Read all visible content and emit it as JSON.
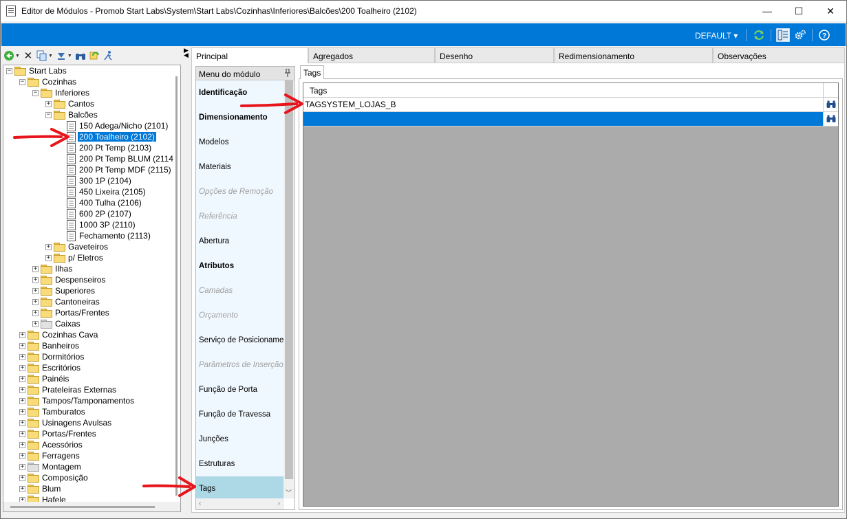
{
  "window": {
    "title": "Editor de Módulos - Promob Start Labs\\System\\Start Labs\\Cozinhas\\Inferiores\\Balcões\\200 Toalheiro (2102)",
    "minimize": "—",
    "maximize": "☐",
    "close": "✕"
  },
  "ribbon": {
    "default_label": "DEFAULT ▾",
    "icons": [
      "refresh-icon",
      "layout-icon",
      "settings-icon",
      "help-icon"
    ]
  },
  "tree": {
    "items": [
      {
        "label": "Start Labs",
        "level": 0,
        "type": "folder",
        "expander": "−"
      },
      {
        "label": "Cozinhas",
        "level": 1,
        "type": "folder",
        "expander": "−"
      },
      {
        "label": "Inferiores",
        "level": 2,
        "type": "folder",
        "expander": "−"
      },
      {
        "label": "Cantos",
        "level": 3,
        "type": "folder",
        "expander": "+"
      },
      {
        "label": "Balcões",
        "level": 3,
        "type": "folder",
        "expander": "−"
      },
      {
        "label": "150 Adega/Nicho (2101)",
        "level": 4,
        "type": "doc"
      },
      {
        "label": "200 Toalheiro (2102)",
        "level": 4,
        "type": "doc",
        "selected": true
      },
      {
        "label": "200 Pt Temp (2103)",
        "level": 4,
        "type": "doc"
      },
      {
        "label": "200 Pt Temp BLUM (2114",
        "level": 4,
        "type": "doc"
      },
      {
        "label": "200 Pt Temp MDF (2115)",
        "level": 4,
        "type": "doc"
      },
      {
        "label": "300 1P (2104)",
        "level": 4,
        "type": "doc"
      },
      {
        "label": "450 Lixeira (2105)",
        "level": 4,
        "type": "doc"
      },
      {
        "label": "400 Tulha (2106)",
        "level": 4,
        "type": "doc"
      },
      {
        "label": "600 2P (2107)",
        "level": 4,
        "type": "doc"
      },
      {
        "label": "1000 3P (2110)",
        "level": 4,
        "type": "doc"
      },
      {
        "label": "Fechamento (2113)",
        "level": 4,
        "type": "doc"
      },
      {
        "label": "Gaveteiros",
        "level": 3,
        "type": "folder",
        "expander": "+"
      },
      {
        "label": "p/ Eletros",
        "level": 3,
        "type": "folder",
        "expander": "+"
      },
      {
        "label": "Ilhas",
        "level": 2,
        "type": "folder",
        "expander": "+"
      },
      {
        "label": "Despenseiros",
        "level": 2,
        "type": "folder",
        "expander": "+"
      },
      {
        "label": "Superiores",
        "level": 2,
        "type": "folder",
        "expander": "+"
      },
      {
        "label": "Cantoneiras",
        "level": 2,
        "type": "folder",
        "expander": "+"
      },
      {
        "label": "Portas/Frentes",
        "level": 2,
        "type": "folder",
        "expander": "+"
      },
      {
        "label": "Caixas",
        "level": 2,
        "type": "folder-gray",
        "expander": "+"
      },
      {
        "label": "Cozinhas Cava",
        "level": 1,
        "type": "folder",
        "expander": "+"
      },
      {
        "label": "Banheiros",
        "level": 1,
        "type": "folder",
        "expander": "+"
      },
      {
        "label": "Dormitórios",
        "level": 1,
        "type": "folder",
        "expander": "+"
      },
      {
        "label": "Escritórios",
        "level": 1,
        "type": "folder",
        "expander": "+"
      },
      {
        "label": "Painéis",
        "level": 1,
        "type": "folder",
        "expander": "+"
      },
      {
        "label": "Prateleiras Externas",
        "level": 1,
        "type": "folder",
        "expander": "+"
      },
      {
        "label": "Tampos/Tamponamentos",
        "level": 1,
        "type": "folder",
        "expander": "+"
      },
      {
        "label": "Tamburatos",
        "level": 1,
        "type": "folder",
        "expander": "+"
      },
      {
        "label": "Usinagens Avulsas",
        "level": 1,
        "type": "folder",
        "expander": "+"
      },
      {
        "label": "Portas/Frentes",
        "level": 1,
        "type": "folder",
        "expander": "+"
      },
      {
        "label": "Acessórios",
        "level": 1,
        "type": "folder",
        "expander": "+"
      },
      {
        "label": "Ferragens",
        "level": 1,
        "type": "folder",
        "expander": "+"
      },
      {
        "label": "Montagem",
        "level": 1,
        "type": "folder-gray",
        "expander": "+"
      },
      {
        "label": "Composição",
        "level": 1,
        "type": "folder",
        "expander": "+"
      },
      {
        "label": "Blum",
        "level": 1,
        "type": "folder",
        "expander": "+"
      },
      {
        "label": "Hafele",
        "level": 1,
        "type": "folder",
        "expander": "+"
      }
    ]
  },
  "tabs": [
    {
      "label": "Principal",
      "active": true
    },
    {
      "label": "Agregados"
    },
    {
      "label": "Desenho"
    },
    {
      "label": "Redimensionamento"
    },
    {
      "label": "Observações"
    }
  ],
  "menu": {
    "header": "Menu do módulo",
    "pin": "📌",
    "items": [
      {
        "label": "Identificação",
        "style": "bold"
      },
      {
        "label": "Dimensionamento",
        "style": "bold"
      },
      {
        "label": "Modelos",
        "style": "normal"
      },
      {
        "label": "Materiais",
        "style": "normal"
      },
      {
        "label": "Opções de Remoção",
        "style": "disabled"
      },
      {
        "label": "Referência",
        "style": "disabled"
      },
      {
        "label": "Abertura",
        "style": "normal"
      },
      {
        "label": "Atributos",
        "style": "bold"
      },
      {
        "label": "Camadas",
        "style": "disabled"
      },
      {
        "label": "Orçamento",
        "style": "disabled"
      },
      {
        "label": "Serviço de Posicionamento",
        "style": "normal"
      },
      {
        "label": "Parâmetros de Inserção",
        "style": "disabled"
      },
      {
        "label": "Função de Porta",
        "style": "normal"
      },
      {
        "label": "Função de Travessa",
        "style": "normal"
      },
      {
        "label": "Junções",
        "style": "normal"
      },
      {
        "label": "Estruturas",
        "style": "normal"
      },
      {
        "label": "Tags",
        "style": "selected"
      }
    ]
  },
  "tags_panel": {
    "subtab": "Tags",
    "column_header": "Tags",
    "rows": [
      "TAGSYSTEM_LOJAS_B",
      ""
    ]
  },
  "colors": {
    "accent": "#0078d7",
    "annotation_arrow": "#e8141c",
    "menu_selected": "#add8e6"
  }
}
